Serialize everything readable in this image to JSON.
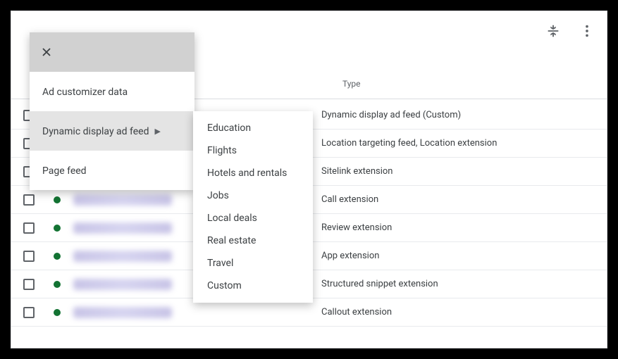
{
  "header": {
    "type_column": "Type"
  },
  "dropdown": {
    "items": [
      {
        "label": "Ad customizer data",
        "has_submenu": false
      },
      {
        "label": "Dynamic display ad feed",
        "has_submenu": true,
        "highlighted": true
      },
      {
        "label": "Page feed",
        "has_submenu": false
      }
    ]
  },
  "submenu": {
    "items": [
      "Education",
      "Flights",
      "Hotels and rentals",
      "Jobs",
      "Local deals",
      "Real estate",
      "Travel",
      "Custom"
    ]
  },
  "table": {
    "rows": [
      {
        "type": "Dynamic display ad feed (Custom)"
      },
      {
        "type": "Location targeting feed, Location extension"
      },
      {
        "type": "Sitelink extension"
      },
      {
        "type": "Call extension"
      },
      {
        "type": "Review extension"
      },
      {
        "type": "App extension"
      },
      {
        "type": "Structured snippet extension"
      },
      {
        "type": "Callout extension"
      }
    ]
  }
}
